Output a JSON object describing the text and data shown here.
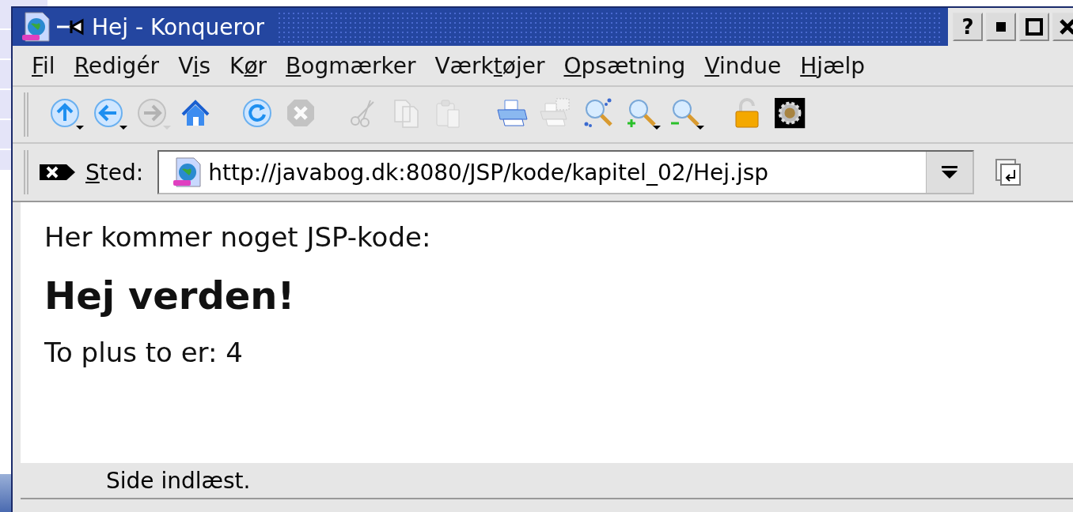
{
  "window": {
    "title": "Hej - Konqueror",
    "help_button": "?"
  },
  "menu": [
    {
      "label": "Fil"
    },
    {
      "label": "Redigér"
    },
    {
      "label": "Vis"
    },
    {
      "label": "Kør"
    },
    {
      "label": "Bogmærker"
    },
    {
      "label": "Værktøjer"
    },
    {
      "label": "Opsætning"
    },
    {
      "label": "Vindue"
    },
    {
      "label": "Hjælp"
    }
  ],
  "toolbar": [
    {
      "kind": "up",
      "disabled": false
    },
    {
      "kind": "back",
      "disabled": false
    },
    {
      "kind": "forward",
      "disabled": true
    },
    {
      "kind": "home",
      "disabled": false
    },
    {
      "kind": "reload",
      "disabled": false
    },
    {
      "kind": "stop",
      "disabled": true
    },
    {
      "kind": "cut",
      "disabled": true
    },
    {
      "kind": "copy",
      "disabled": true
    },
    {
      "kind": "paste",
      "disabled": true
    },
    {
      "kind": "print",
      "disabled": false
    },
    {
      "kind": "printframe",
      "disabled": true
    },
    {
      "kind": "find",
      "disabled": false
    },
    {
      "kind": "zoomin",
      "disabled": false
    },
    {
      "kind": "zoomout",
      "disabled": false
    },
    {
      "kind": "lock",
      "disabled": false
    },
    {
      "kind": "gear",
      "disabled": false
    }
  ],
  "location": {
    "label": "Sted:",
    "url": "http://javabog.dk:8080/JSP/kode/kapitel_02/Hej.jsp"
  },
  "page": {
    "intro": "Her kommer noget JSP-kode:",
    "heading": "Hej verden!",
    "result": "To plus to er: 4"
  },
  "status_bar": "Side indlæst."
}
